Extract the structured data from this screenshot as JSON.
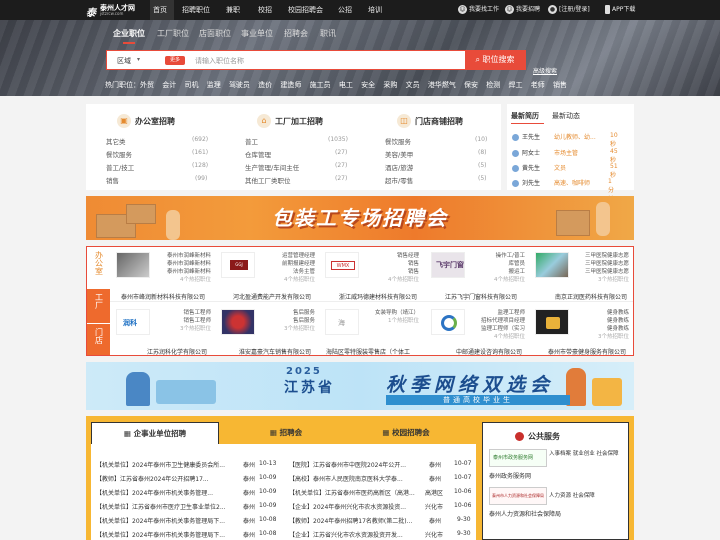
{
  "topnav": {
    "logo_mark": "泰",
    "logo_title": "泰州人才网",
    "logo_sub": "jstzrcw.com",
    "items": [
      "首页",
      "招聘职位",
      "兼职",
      "校招",
      "校园招聘会",
      "公招",
      "培训"
    ],
    "right": [
      {
        "icon": "user-icon",
        "label": "我要找工作"
      },
      {
        "icon": "user-icon",
        "label": "我要招聘"
      },
      {
        "icon": "person-icon",
        "label": "[注册/登录]"
      },
      {
        "icon": "phone-icon",
        "label": "APP下载"
      }
    ]
  },
  "hero": {
    "tabs": [
      "企业职位",
      "工厂职位",
      "店面职位",
      "事业单位",
      "招聘会",
      "职讯"
    ],
    "active_tab": 0,
    "search": {
      "region": "区域",
      "more": "更多",
      "placeholder": "请输入职位名称",
      "button": "职位搜索",
      "advanced": "高级搜索"
    },
    "hot_label": "热门职位：外贸",
    "hot": [
      "会计",
      "司机",
      "监理",
      "驾驶员",
      "造价",
      "建造师",
      "施工员",
      "电工",
      "安全",
      "采购",
      "文员",
      "港华燃气",
      "保安",
      "检测",
      "焊工",
      "老师",
      "销售"
    ]
  },
  "categories": [
    {
      "title": "办公室招聘",
      "icon": "briefcase-icon",
      "icon_glyph": "▣",
      "items": [
        {
          "label": "其它类",
          "count": "(692)"
        },
        {
          "label": "餐饮服务",
          "count": "(161)"
        },
        {
          "label": "普工/技工",
          "count": "(128)"
        },
        {
          "label": "销售",
          "count": "(99)"
        }
      ]
    },
    {
      "title": "工厂加工招聘",
      "icon": "factory-icon",
      "icon_glyph": "⌂",
      "items": [
        {
          "label": "普工",
          "count": "(1035)"
        },
        {
          "label": "仓库管理",
          "count": "(27)"
        },
        {
          "label": "生产管理/车间主任",
          "count": "(27)"
        },
        {
          "label": "其他工厂类职位",
          "count": "(27)"
        }
      ]
    },
    {
      "title": "门店商铺招聘",
      "icon": "store-icon",
      "icon_glyph": "◫",
      "items": [
        {
          "label": "餐饮服务",
          "count": "(10)"
        },
        {
          "label": "美容/美甲",
          "count": "(8)"
        },
        {
          "label": "酒店/旅游",
          "count": "(5)"
        },
        {
          "label": "超市/零售",
          "count": "(5)"
        }
      ]
    }
  ],
  "news": {
    "tabs": [
      "最新简历",
      "最新动态"
    ],
    "rows": [
      {
        "name": "王先生",
        "job": "幼儿教师、幼...",
        "time": "10秒"
      },
      {
        "name": "阿女士",
        "job": "市场主管",
        "time": "45秒"
      },
      {
        "name": "黄先生",
        "job": "文员",
        "time": "51秒"
      },
      {
        "name": "刘先生",
        "job": "高速、咖啡师",
        "time": "1分钟"
      }
    ]
  },
  "banner1": {
    "text": "包装工专场招聘会"
  },
  "companies": {
    "tabs": [
      "办公室",
      "工厂",
      "门店"
    ],
    "rows": [
      [
        {
          "logo": "photo",
          "jobs": [
            "泰州市润峰新材料",
            "泰州市润峰新材料",
            "泰州市润峰新材料"
          ],
          "count": "4个热招职位",
          "company": "泰州市峰润新材料科技有限公司"
        },
        {
          "logo": "GGJ",
          "jobs": [
            "运营管理经理",
            "前期报建经理",
            "法务主管"
          ],
          "count": "4个热招职位",
          "company": "河北盈通费能产开发有限公司"
        },
        {
          "logo": "WMX",
          "jobs": [
            "销售经理",
            "销售",
            "销售"
          ],
          "count": "4个热招职位",
          "company": "浙江威玛德建材科技有限公司"
        },
        {
          "logo": "飞宇门窗",
          "jobs": [
            "操作工/普工",
            "库管员",
            "搬运工"
          ],
          "count": "4个热招职位",
          "company": "江苏飞宇门窗科技有限公司"
        },
        {
          "logo": "photo",
          "jobs": [
            "三甲医院健康志愿",
            "三甲医院健康志愿",
            "三甲医院健康志愿"
          ],
          "count": "3个热招职位",
          "company": "南京正润医药科技有限公司"
        }
      ],
      [
        {
          "logo": "润科",
          "jobs": [
            "销售工程师",
            "销售工程师",
            ""
          ],
          "count": "3个热招职位",
          "company": "江苏润科化学有限公司"
        },
        {
          "logo": "car",
          "jobs": [
            "售后服务",
            "售后服务",
            ""
          ],
          "count": "3个热招职位",
          "company": "淮安嘉豪汽车销售有限公司"
        },
        {
          "logo": "海",
          "jobs": [
            "女装导购（靖江）",
            "",
            ""
          ],
          "count": "1个热招职位",
          "company": "海陆区零特服装零售店（个体工"
        },
        {
          "logo": "swirl",
          "jobs": [
            "监理工程师",
            "招标代理项目经理",
            "监理工程师（实习"
          ],
          "count": "4个热招职位",
          "company": "中邮通建设咨询有限公司"
        },
        {
          "logo": "gym",
          "jobs": [
            "健身教练",
            "健身教练",
            "健身教练"
          ],
          "count": "3个热招职位",
          "company": "泰州市带豪健身服务有限公司"
        }
      ]
    ]
  },
  "banner2": {
    "year": "2025",
    "province": "江苏省",
    "title": "秋季网络双选会",
    "sub": "普通高校毕业生"
  },
  "bottom": {
    "tabs": [
      {
        "icon": "building-icon",
        "label": "企事业单位招聘"
      },
      {
        "icon": "grid-icon",
        "label": "招聘会"
      },
      {
        "icon": "school-icon",
        "label": "校园招聘会"
      }
    ],
    "left_rows": [
      {
        "text": "【机关单位】2024年泰州市卫生健康委员会所...",
        "city": "泰州",
        "date": "10-13"
      },
      {
        "text": "【教师】江苏省泰州2024年公开招聘17...",
        "city": "泰州",
        "date": "10-09"
      },
      {
        "text": "【机关单位】2024年泰州市机关事务管理...",
        "city": "泰州",
        "date": "10-09"
      },
      {
        "text": "【机关单位】江苏省泰州市医疗卫生事业单位2...",
        "city": "泰州",
        "date": "10-09"
      },
      {
        "text": "【机关单位】2024年泰州市机关事务管理局下...",
        "city": "泰州",
        "date": "10-08"
      },
      {
        "text": "【机关单位】2024年泰州市机关事务管理局下...",
        "city": "泰州",
        "date": "10-08"
      }
    ],
    "right_rows": [
      {
        "text": "【医院】江苏省泰州市中医院2024年公开...",
        "city": "泰州",
        "date": "10-07"
      },
      {
        "text": "【高校】泰州市人民医院南京医科大学泰...",
        "city": "泰州",
        "date": "10-07"
      },
      {
        "text": "【机关单位】江苏省泰州市医药高新区（高港...",
        "city": "高港区",
        "date": "10-06"
      },
      {
        "text": "【企业】2024年泰州兴化市农水资源投资...",
        "city": "兴化市",
        "date": "10-06"
      },
      {
        "text": "【教师】2024年泰州招聘17名教师(第二批)...",
        "city": "泰州",
        "date": "9-30"
      },
      {
        "text": "【企业】江苏省兴化市农水资源投资开发...",
        "city": "兴化市",
        "date": "9-30"
      }
    ]
  },
  "service": {
    "title": "公共服务",
    "items": [
      {
        "org": "泰州市政务服务网",
        "tags": "入事档案  就业创业  社会保障",
        "name": "泰州政务服务网"
      },
      {
        "org": "泰州市人力资源和社会保障局",
        "tags": "人力资源  社会保障",
        "name": "泰州人力资源和社会保障局"
      }
    ]
  },
  "colors": {
    "accent": "#e84b3a",
    "orange": "#ee6a2d",
    "yellow": "#f7b733",
    "dark": "#1c1c1c"
  }
}
